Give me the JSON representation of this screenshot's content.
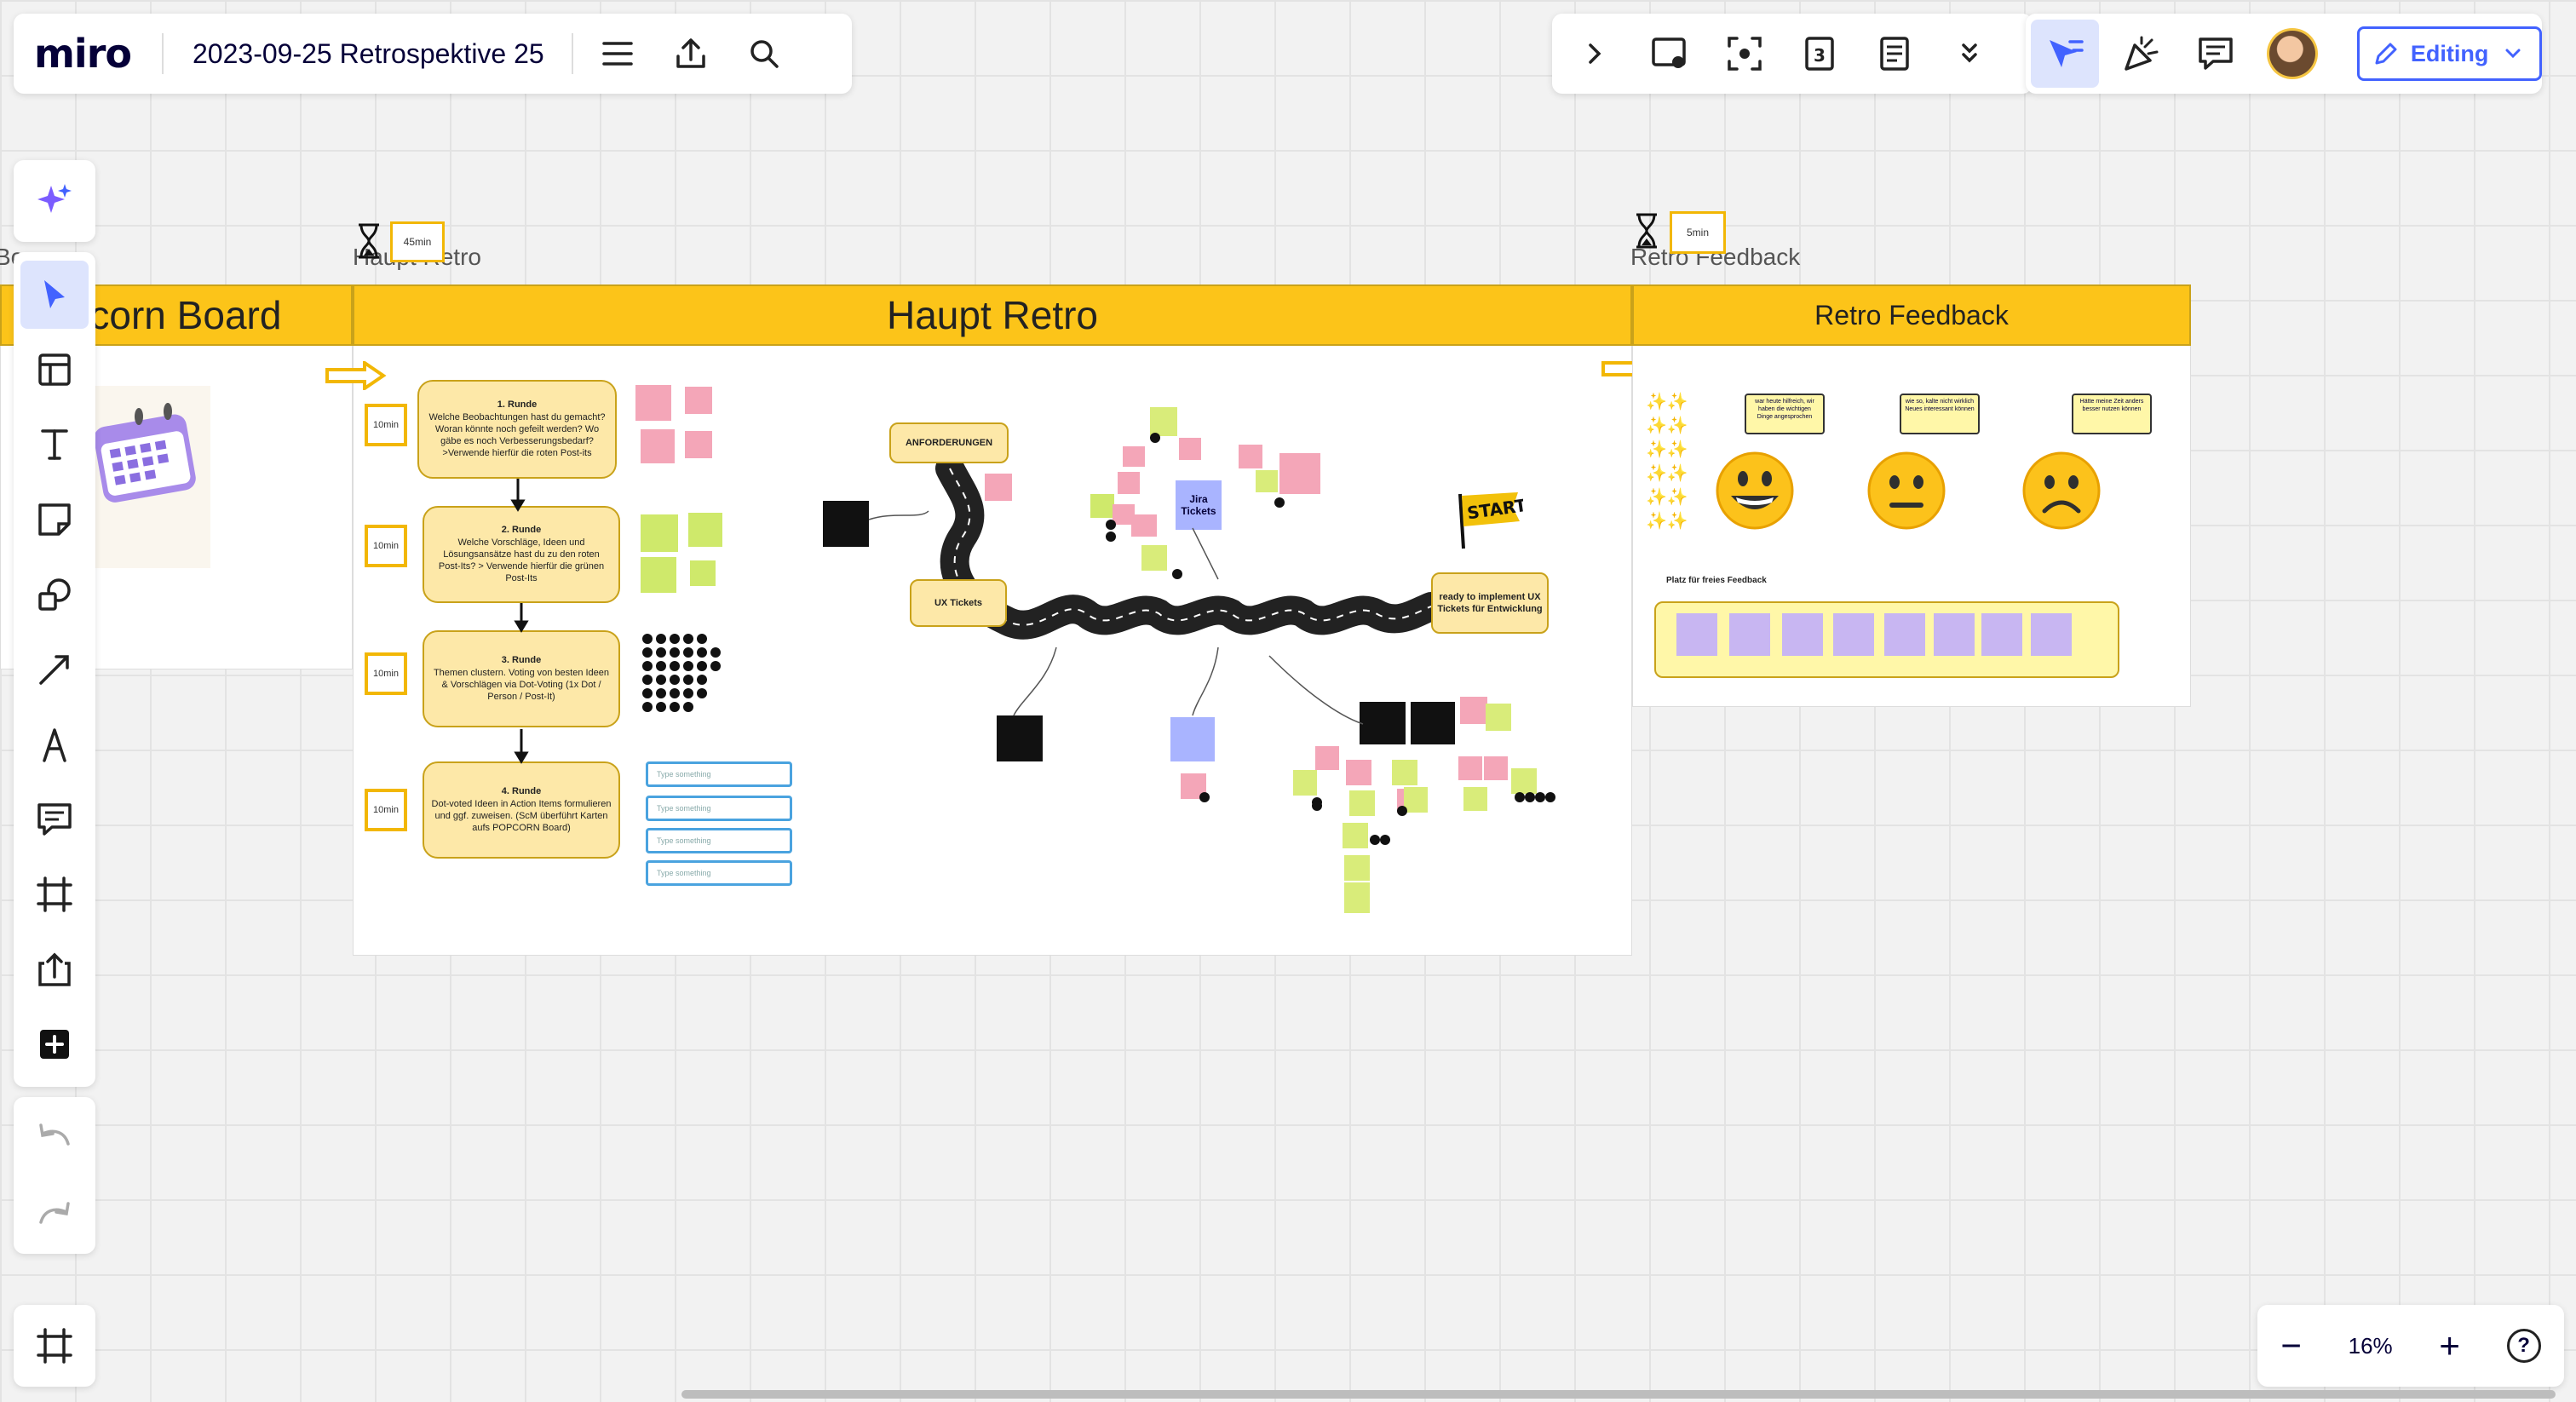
{
  "app": {
    "logo": "miro",
    "board_title": "2023-09-25 Retrospektive 25"
  },
  "toolbar_right": {
    "editing_label": "Editing"
  },
  "zoom": {
    "minus": "−",
    "level": "16%",
    "plus": "+",
    "help": "?"
  },
  "frames": {
    "popcorn": {
      "title": "Popcorn Board",
      "label": "Bo"
    },
    "main": {
      "title": "Haupt Retro",
      "label": "Haupt Retro",
      "timer": "45min"
    },
    "feedback": {
      "title": "Retro Feedback",
      "label": "Retro Feedback",
      "timer": "5min"
    }
  },
  "rounds": [
    {
      "time": "10min",
      "title": "1. Runde",
      "text": "Welche Beobachtungen hast du gemacht? Woran könnte noch gefeilt werden? Wo gäbe es noch Verbesserungsbedarf? >Verwende hierfür die roten Post-its"
    },
    {
      "time": "10min",
      "title": "2. Runde",
      "text": "Welche Vorschläge, Ideen und Lösungsansätze hast du zu den roten Post-Its? > Verwende hierfür die grünen Post-Its"
    },
    {
      "time": "10min",
      "title": "3. Runde",
      "text": "Themen clustern. Voting von besten Ideen & Vorschlägen via Dot-Voting (1x Dot / Person / Post-It)"
    },
    {
      "time": "10min",
      "title": "4. Runde",
      "text": "Dot-voted Ideen in Action Items formulieren und ggf. zuweisen. (ScM überführt Karten aufs POPCORN Board)"
    }
  ],
  "type_placeholder": "Type something",
  "road": {
    "anforderungen": "ANFORDERUNGEN",
    "ux_tickets": "UX Tickets",
    "jira_tickets": "Jira Tickets",
    "ready": "ready to implement UX Tickets für Entwicklung",
    "start": "START"
  },
  "feedback": {
    "bubbles": [
      "war heute hilfreich, wir haben die wichtigen Dinge angesprochen",
      "wie so, kalte nicht wirklich Neues interessant können",
      "Hätte meine Zeit anders besser nutzen können"
    ],
    "free_label": "Platz für freies Feedback"
  },
  "colors": {
    "accent": "#4262ff",
    "frame_header": "#fcc419",
    "sticky_pink": "#f4a6b8",
    "sticky_green": "#cfe96b",
    "sticky_violet": "#c8b6f2"
  }
}
